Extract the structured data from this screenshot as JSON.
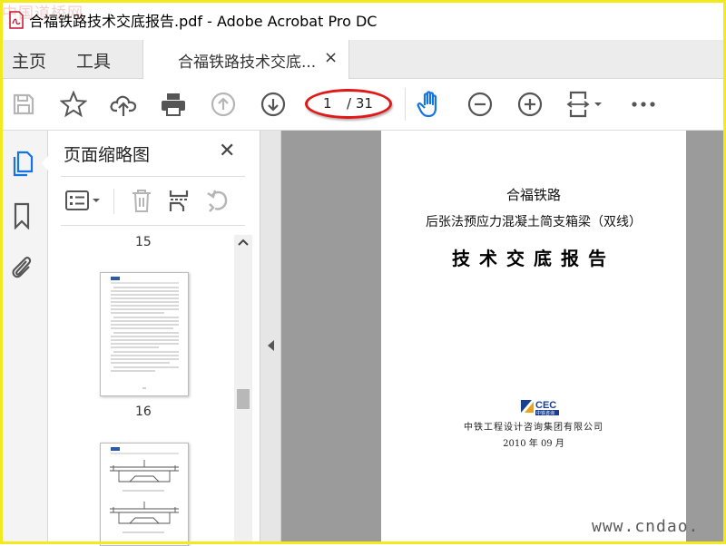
{
  "window": {
    "title": "合福铁路技术交底报告.pdf - Adobe Acrobat Pro DC",
    "watermark_top": "中国道桥网"
  },
  "menu": {
    "home": "主页",
    "tools": "工具"
  },
  "doc_tab": {
    "label": "合福铁路技术交底...",
    "close": "×"
  },
  "toolbar": {
    "current_page": "1",
    "total_pages": "/ 31",
    "icons": [
      "save-icon",
      "star-icon",
      "cloud-upload-icon",
      "print-icon",
      "page-up-icon",
      "page-down-icon",
      "hand-icon",
      "zoom-out-icon",
      "zoom-in-icon",
      "fit-page-icon",
      "more-icon"
    ]
  },
  "panel": {
    "title": "页面缩略图",
    "close": "✕",
    "thumbnails": [
      {
        "number": "15"
      },
      {
        "number": "16"
      }
    ]
  },
  "document": {
    "line1": "合福铁路",
    "line2": "后张法预应力混凝土简支箱梁（双线）",
    "line3": "技术交底报告",
    "logo_text": "CEC",
    "logo_subtext": "中铁咨询",
    "org": "中铁工程设计咨询集团有限公司",
    "date": "2010 年 09 月"
  },
  "watermark_bottom": "www.cndao.",
  "colors": {
    "highlight_oval": "#e01818",
    "accent_blue": "#1473e6",
    "frame": "#f2ea1f"
  }
}
